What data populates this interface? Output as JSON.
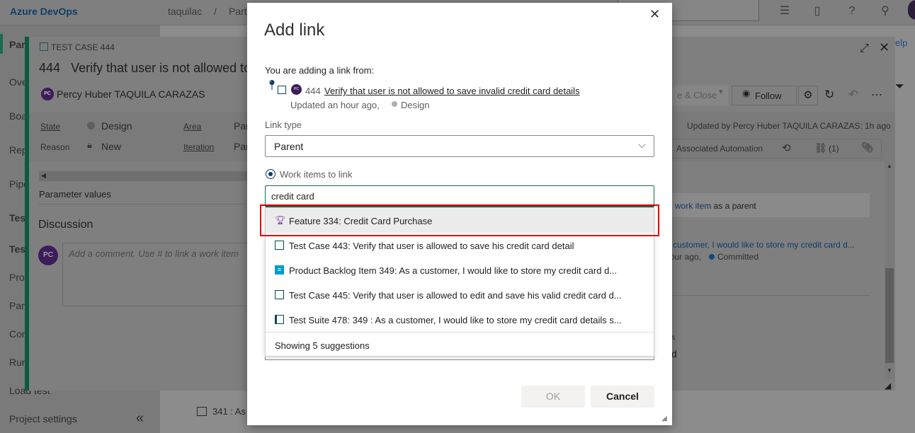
{
  "topbar": {
    "brand": "Azure DevOps",
    "crumb_org": "taquilac",
    "crumb_sep": "/",
    "crumb_project": "Parts"
  },
  "leftnav": {
    "items": [
      "Par",
      "Ove",
      "Boa",
      "Rep",
      "Pipe",
      "Test",
      "Test",
      "Pro",
      "Para",
      "Con",
      "Run",
      "Load test"
    ],
    "project_settings": "Project settings",
    "collapse_glyph": "«"
  },
  "bottomrow": {
    "text": "341 : As"
  },
  "workitem": {
    "type_label": "TEST CASE 444",
    "id": "444",
    "title": "Verify that user is not allowed to",
    "owner_initials": "PC",
    "owner": "Percy Huber TAQUILA CARAZAS",
    "state_label": "State",
    "state_value": "Design",
    "reason_label": "Reason",
    "reason_value": "New",
    "area_label": "Area",
    "area_value": "Par",
    "iteration_label": "Iteration",
    "iteration_value": "Par",
    "parameter_values": "Parameter values",
    "discussion": "Discussion",
    "discussion_avatar": "PC",
    "comment_placeholder": "Add a comment. Use # to link a work item",
    "help": "elp",
    "save_close": "e & Close",
    "follow": "Follow",
    "updated_by": "Updated by Percy Huber TAQUILA CARAZAS: 1h ago",
    "associated_automation": "Associated Automation",
    "links_count": "(1)",
    "related_line1_link": "work item",
    "related_line1_rest": " as a parent",
    "related_line2": "customer, I would like to store my credit card d...",
    "related_line3a": "our ago,",
    "related_line3b": "Committed",
    "right_s": "s",
    "right_d": "d"
  },
  "dialog": {
    "title": "Add link",
    "close_glyph": "✕",
    "from_label": "You are adding a link from:",
    "from_avatar": "PC",
    "from_id": "444",
    "from_title": "Verify that user is not allowed to save invalid credit card details",
    "from_updated": "Updated an hour ago,",
    "from_state": "Design",
    "link_type_label": "Link type",
    "link_type_value": "Parent",
    "work_items_label": "Work items to link",
    "search_value": "credit card",
    "suggestions": [
      {
        "icon": "trophy-icon",
        "text": "Feature 334: Credit Card Purchase"
      },
      {
        "icon": "test-case-icon",
        "text": "Test Case 443: Verify that user is allowed to save his credit card detail"
      },
      {
        "icon": "backlog-item-icon",
        "text": "Product Backlog Item 349: As a customer, I would like to store my credit card d..."
      },
      {
        "icon": "test-case-icon",
        "text": "Test Case 445: Verify that user is allowed to edit and save his valid credit card d..."
      },
      {
        "icon": "test-suite-icon",
        "text": "Test Suite 478: 349 : As a customer, I would like to store my credit card details s..."
      }
    ],
    "suggestions_footer": "Showing 5 suggestions",
    "ok": "OK",
    "cancel": "Cancel"
  },
  "colors": {
    "accent": "#1b6a52",
    "highlight": "#e00000",
    "feature": "#773b93",
    "backlog": "#009ccc",
    "test": "#004b50"
  }
}
